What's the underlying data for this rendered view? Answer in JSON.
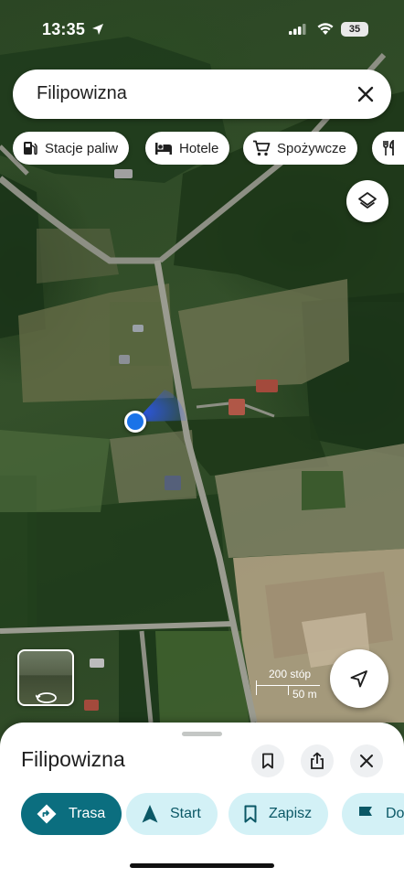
{
  "status_bar": {
    "time": "13:35",
    "battery": "35"
  },
  "search": {
    "query": "Filipowizna"
  },
  "chips": [
    {
      "label": "Stacje paliw",
      "icon": "gas-station-icon"
    },
    {
      "label": "Hotele",
      "icon": "bed-icon"
    },
    {
      "label": "Spożywcze",
      "icon": "shopping-cart-icon"
    },
    {
      "label": "",
      "icon": "restaurant-icon"
    }
  ],
  "map": {
    "scale_top": "200 stóp",
    "scale_bottom": "50 m",
    "location_dot_color": "#1a73e8"
  },
  "place": {
    "title": "Filipowizna"
  },
  "actions": [
    {
      "label": "Trasa",
      "icon": "directions-icon",
      "style": "primary"
    },
    {
      "label": "Start",
      "icon": "navigation-arrow-icon",
      "style": "secondary"
    },
    {
      "label": "Zapisz",
      "icon": "bookmark-icon",
      "style": "secondary"
    },
    {
      "label": "Do",
      "icon": "flag-icon",
      "style": "secondary"
    }
  ],
  "colors": {
    "primary_action": "#0b6e7f",
    "secondary_action": "#d3f1f6"
  }
}
